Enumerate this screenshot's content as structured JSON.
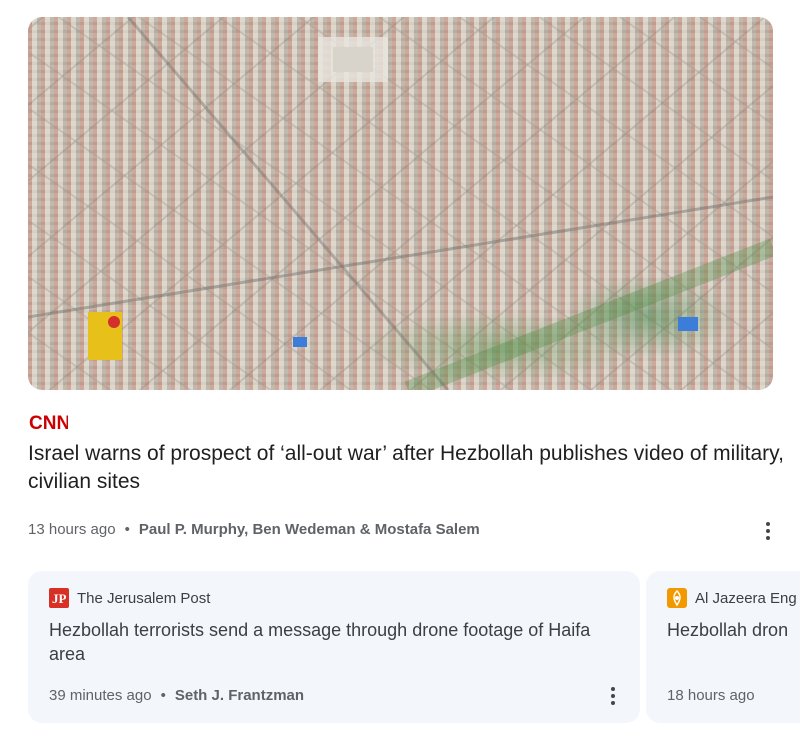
{
  "main_story": {
    "image_alt": "Aerial view of a dense residential neighborhood",
    "source": "CNN",
    "headline": "Israel warns of prospect of ‘all-out war’ after Hezbollah publishes video of military, civilian sites",
    "time": "13 hours ago",
    "separator": "•",
    "authors": "Paul P. Murphy, Ben Wedeman & Mostafa Salem"
  },
  "related": [
    {
      "source": "The Jerusalem Post",
      "logo_text": "JP",
      "logo_color": "#d93025",
      "title": "Hezbollah terrorists send a message through drone footage of Haifa area",
      "time": "39 minutes ago",
      "separator": "•",
      "authors": "Seth J. Frantzman"
    },
    {
      "source": "Al Jazeera Eng",
      "logo_color": "#f29900",
      "title": "Hezbollah dron",
      "time": "18 hours ago"
    }
  ],
  "colors": {
    "cnn_red": "#cc0000",
    "card_bg": "#f3f6fb",
    "meta_gray": "#5f6368"
  },
  "icons": [
    "more-vert-icon",
    "cnn-logo",
    "jpost-logo",
    "aljazeera-logo"
  ]
}
